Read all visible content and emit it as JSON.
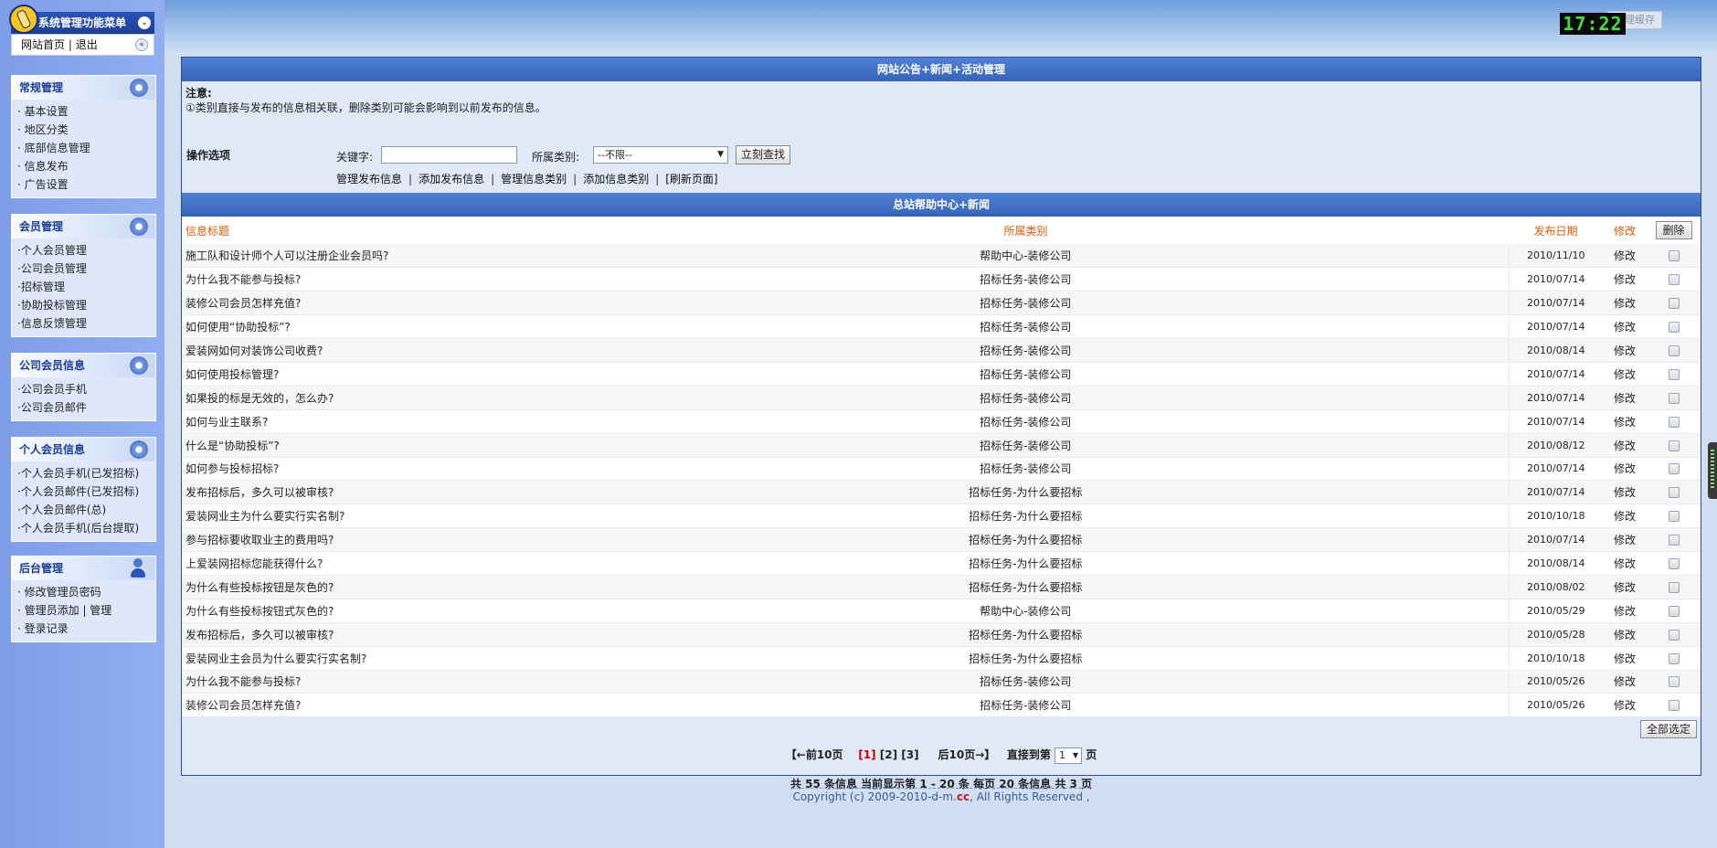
{
  "header": {
    "clock": "17:22",
    "clock_button": "清理缓存"
  },
  "sidebar": {
    "title": "系统管理功能菜单",
    "home_link": "网站首页",
    "logout_link": "退出",
    "groups": [
      {
        "title": "常规管理",
        "items": [
          "· 基本设置",
          "· 地区分类",
          "· 底部信息管理",
          "· 信息发布",
          "· 广告设置"
        ]
      },
      {
        "title": "会员管理",
        "items": [
          "·个人会员管理",
          "·公司会员管理",
          "·招标管理",
          "·协助投标管理",
          "·信息反馈管理"
        ]
      },
      {
        "title": "公司会员信息",
        "items": [
          "·公司会员手机",
          "·公司会员邮件"
        ]
      },
      {
        "title": "个人会员信息",
        "items": [
          "·个人会员手机(已发招标)",
          "·个人会员邮件(已发招标)",
          "·个人会员邮件(总)",
          "·个人会员手机(后台提取)"
        ]
      },
      {
        "title": "后台管理",
        "items": [
          "· 修改管理员密码",
          "· 管理员添加 | 管理",
          "· 登录记录"
        ]
      }
    ]
  },
  "main": {
    "title": "网站公告+新闻+活动管理",
    "notice_title": "注意:",
    "notice_text": "①类别直接与发布的信息相关联，删除类别可能会影响到以前发布的信息。",
    "ops_label": "操作选项",
    "keyword_label": "关键字:",
    "keyword_value": "",
    "category_label": "所属类别:",
    "category_selected": "--不限--",
    "search_button": "立刻查找",
    "links": [
      "管理发布信息",
      "添加发布信息",
      "管理信息类别",
      "添加信息类别",
      "[刷新页面]"
    ],
    "list_title": "总站帮助中心+新闻",
    "columns": {
      "title": "信息标题",
      "category": "所属类别",
      "date": "发布日期",
      "edit": "修改",
      "delete": "删除"
    },
    "rows": [
      {
        "title": "施工队和设计师个人可以注册企业会员吗?",
        "category": "帮助中心-装修公司",
        "date": "2010/11/10",
        "edit": "修改"
      },
      {
        "title": "为什么我不能参与投标?",
        "category": "招标任务-装修公司",
        "date": "2010/07/14",
        "edit": "修改"
      },
      {
        "title": "装修公司会员怎样充值?",
        "category": "招标任务-装修公司",
        "date": "2010/07/14",
        "edit": "修改"
      },
      {
        "title": "如何使用“协助投标”?",
        "category": "招标任务-装修公司",
        "date": "2010/07/14",
        "edit": "修改"
      },
      {
        "title": "爱装网如何对装饰公司收费?",
        "category": "招标任务-装修公司",
        "date": "2010/08/14",
        "edit": "修改"
      },
      {
        "title": "如何使用投标管理?",
        "category": "招标任务-装修公司",
        "date": "2010/07/14",
        "edit": "修改"
      },
      {
        "title": "如果投的标是无效的，怎么办?",
        "category": "招标任务-装修公司",
        "date": "2010/07/14",
        "edit": "修改"
      },
      {
        "title": "如何与业主联系?",
        "category": "招标任务-装修公司",
        "date": "2010/07/14",
        "edit": "修改"
      },
      {
        "title": "什么是“协助投标”?",
        "category": "招标任务-装修公司",
        "date": "2010/08/12",
        "edit": "修改"
      },
      {
        "title": "如何参与投标招标?",
        "category": "招标任务-装修公司",
        "date": "2010/07/14",
        "edit": "修改"
      },
      {
        "title": "发布招标后，多久可以被审核?",
        "category": "招标任务-为什么要招标",
        "date": "2010/07/14",
        "edit": "修改"
      },
      {
        "title": "爱装网业主为什么要实行实名制?",
        "category": "招标任务-为什么要招标",
        "date": "2010/10/18",
        "edit": "修改"
      },
      {
        "title": "参与招标要收取业主的费用吗?",
        "category": "招标任务-为什么要招标",
        "date": "2010/07/14",
        "edit": "修改"
      },
      {
        "title": "上爱装网招标您能获得什么?",
        "category": "招标任务-为什么要招标",
        "date": "2010/08/14",
        "edit": "修改"
      },
      {
        "title": "为什么有些投标按钮是灰色的?",
        "category": "招标任务-为什么要招标",
        "date": "2010/08/02",
        "edit": "修改"
      },
      {
        "title": "为什么有些投标按钮式灰色的?",
        "category": "帮助中心-装修公司",
        "date": "2010/05/29",
        "edit": "修改"
      },
      {
        "title": "发布招标后，多久可以被审核?",
        "category": "招标任务-为什么要招标",
        "date": "2010/05/28",
        "edit": "修改"
      },
      {
        "title": "爱装网业主会员为什么要实行实名制?",
        "category": "招标任务-为什么要招标",
        "date": "2010/10/18",
        "edit": "修改"
      },
      {
        "title": "为什么我不能参与投标?",
        "category": "招标任务-装修公司",
        "date": "2010/05/26",
        "edit": "修改"
      },
      {
        "title": "装修公司会员怎样充值?",
        "category": "招标任务-装修公司",
        "date": "2010/05/26",
        "edit": "修改"
      }
    ],
    "select_all_button": "全部选定",
    "pager": {
      "prev10": "【←前10页",
      "pages": [
        "[1]",
        "[2]",
        "[3]"
      ],
      "next10": "后10页→】",
      "jump_label": "直接到第",
      "jump_value": "1",
      "page_unit": "页"
    },
    "summary": "共 55 条信息 当前显示第 1 - 20 条 每页 20 条信息 共 3 页"
  },
  "footer": {
    "copyright_prefix": "Copyright (c) 2009-2010-d-m.",
    "copyright_cc": "cc",
    "copyright_suffix": ", All Rights Reserved ,"
  }
}
